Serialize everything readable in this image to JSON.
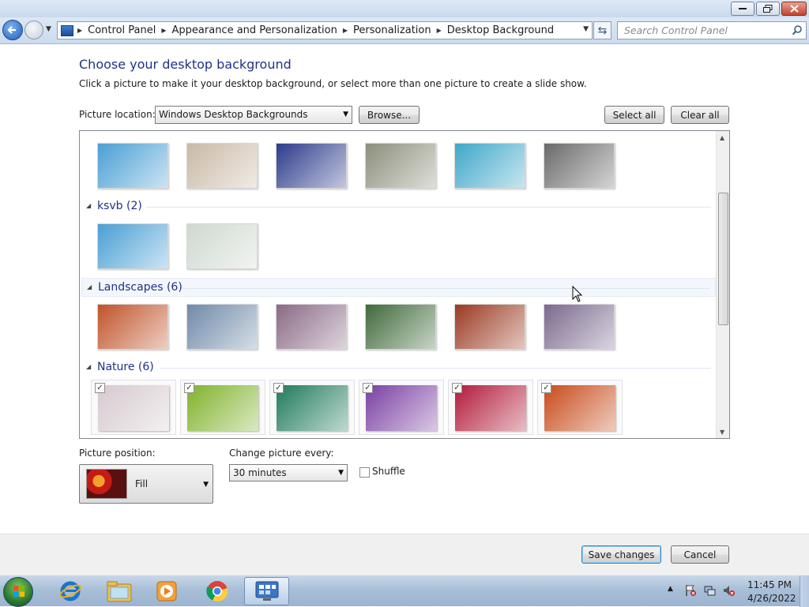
{
  "window": {
    "controls": {
      "minimize": "minimize",
      "maximize": "maximize",
      "close": "close"
    }
  },
  "address": {
    "crumbs": [
      "Control Panel",
      "Appearance and Personalization",
      "Personalization",
      "Desktop Background"
    ]
  },
  "search": {
    "placeholder": "Search Control Panel"
  },
  "page": {
    "title": "Choose your desktop background",
    "subtitle": "Click a picture to make it your desktop background, or select more than one picture to create a slide show."
  },
  "location": {
    "label": "Picture location:",
    "value": "Windows Desktop Backgrounds",
    "browse": "Browse...",
    "select_all": "Select all",
    "clear_all": "Clear all"
  },
  "groups": [
    {
      "name": "ksvb (2)"
    },
    {
      "name": "Landscapes (6)"
    },
    {
      "name": "Nature (6)"
    }
  ],
  "thumb_colors": {
    "row0": [
      "#4a9fd4",
      "#c9b9a6",
      "#2d3b8c",
      "#8b8f7c",
      "#3fa7c9",
      "#6a6a6a"
    ],
    "ksvb": [
      "#4a9fd4",
      "#cfd8cf"
    ],
    "landscapes": [
      "#c0532a",
      "#6f8aa8",
      "#8a6a86",
      "#3f6a3a",
      "#9b3a22",
      "#7b6a8e"
    ],
    "nature": [
      "#d6c9cf",
      "#7fb22a",
      "#1f7a5a",
      "#7a3fa2",
      "#b21a3a",
      "#c84a1a"
    ]
  },
  "position": {
    "label": "Picture position:",
    "value": "Fill"
  },
  "interval": {
    "label": "Change picture every:",
    "value": "30 minutes"
  },
  "shuffle": {
    "label": "Shuffle",
    "checked": false
  },
  "footer": {
    "save": "Save changes",
    "cancel": "Cancel"
  },
  "taskbar": {
    "apps": [
      "internet-explorer-icon",
      "windows-explorer-icon",
      "media-player-icon",
      "chrome-icon",
      "control-panel-icon"
    ],
    "time": "11:45 PM",
    "date": "4/26/2022"
  }
}
